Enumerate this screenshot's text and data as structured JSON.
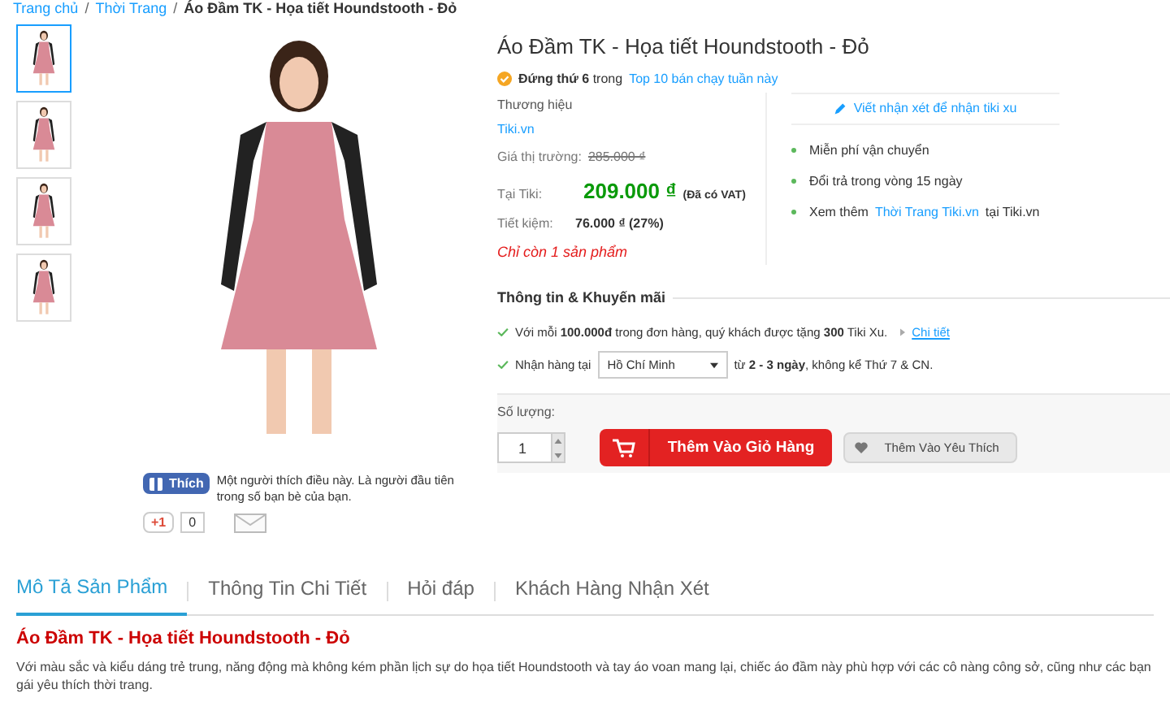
{
  "breadcrumb_separator": "/",
  "breadcrumb": [
    {
      "label": "Trang chủ",
      "link": true
    },
    {
      "label": "Thời Trang",
      "link": true
    },
    {
      "label": "Áo Đầm TK - Họa tiết Houndstooth - Đỏ",
      "link": false
    }
  ],
  "thumbnails": [
    {
      "selected": true
    },
    {
      "selected": false
    },
    {
      "selected": false
    },
    {
      "selected": false
    }
  ],
  "social": {
    "like_button": "Thích",
    "like_text": "Một người thích điều này. Là người đầu tiên trong số bạn bè của bạn.",
    "gplus": "+1",
    "gplus_count": "0"
  },
  "product": {
    "title": "Áo Đầm TK - Họa tiết Houndstooth - Đỏ",
    "rank_text": "**Đứng thứ 6** trong",
    "rank_link": "Top 10 bán chạy tuần này",
    "brand_label": "Thương hiệu",
    "brand": "Tiki.vn",
    "prices": [
      {
        "kind": "market",
        "label": "Giá thị trường:",
        "value": "285.000 ₫"
      },
      {
        "kind": "sale",
        "label": "Tại Tiki:",
        "value": "209.000 ₫",
        "note": "(Đã có VAT)"
      },
      {
        "kind": "save",
        "label": "Tiết kiệm:",
        "value": "76.000 ₫ (27%)"
      }
    ],
    "stock": "Chỉ còn 1 sản phẩm"
  },
  "review_link": "Viết nhận xét để nhận tiki xu",
  "benefits": [
    {
      "text": "Miễn phí vận chuyển"
    },
    {
      "text": "Đổi trả trong vòng 15 ngày"
    },
    {
      "text": "Xem thêm",
      "link": "Thời Trang Tiki.vn",
      "after": "tại Tiki.vn"
    }
  ],
  "promo": {
    "title": "Thông tin & Khuyến mãi",
    "offer": "Với mỗi **100.000đ** trong đơn hàng, quý khách được tặng **300** Tiki Xu.",
    "detail_link": "Chi tiết",
    "delivery_label": "Nhận hàng tại",
    "city": "Hồ Chí Minh",
    "delivery_text": "từ **2 - 3 ngày**, không kể Thứ 7 & CN."
  },
  "quantity": {
    "label": "Số lượng:",
    "value": "1"
  },
  "buttons": {
    "cart": "Thêm Vào Giỏ Hàng",
    "wishlist": "Thêm Vào Yêu Thích"
  },
  "tabs": [
    {
      "label": "Mô Tả Sản Phẩm",
      "selected": true
    },
    {
      "label": "Thông Tin Chi Tiết",
      "selected": false
    },
    {
      "label": "Hỏi đáp",
      "selected": false
    },
    {
      "label": "Khách Hàng Nhận Xét",
      "selected": false
    }
  ],
  "description": {
    "title": "Áo Đầm TK - Họa tiết Houndstooth - Đỏ",
    "text": "Với màu sắc và kiểu dáng trẻ trung, năng động mà không kém phần lịch sự do họa tiết Houndstooth và tay áo voan mang lại, chiếc áo đầm này phù hợp với các cô nàng công sở, cũng như các bạn gái yêu thích thời trang."
  }
}
